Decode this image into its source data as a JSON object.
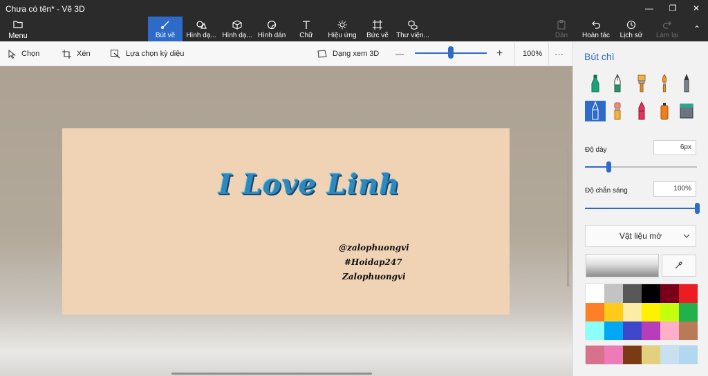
{
  "window": {
    "title": "Chưa có tên* - Vẽ 3D",
    "minimize_glyph": "—",
    "maximize_glyph": "❐",
    "close_glyph": "✕"
  },
  "menu": {
    "label": "Menu",
    "icon": "folder-icon"
  },
  "ribbon": {
    "tools": [
      {
        "label": "Bút vẽ",
        "icon": "brush-icon",
        "active": true
      },
      {
        "label": "Hình dạ...",
        "icon": "shapes-2d-icon",
        "active": false
      },
      {
        "label": "Hình dạ...",
        "icon": "cube-3d-icon",
        "active": false
      },
      {
        "label": "Hình dán",
        "icon": "sticker-icon",
        "active": false
      },
      {
        "label": "Chữ",
        "icon": "text-icon",
        "active": false
      },
      {
        "label": "Hiệu ứng",
        "icon": "effects-icon",
        "active": false
      },
      {
        "label": "Bức vẽ",
        "icon": "canvas-icon",
        "active": false
      },
      {
        "label": "Thư viện...",
        "icon": "library-icon",
        "active": false
      }
    ],
    "right": [
      {
        "label": "Dán",
        "icon": "paste-icon",
        "disabled": true
      },
      {
        "label": "Hoàn tác",
        "icon": "undo-icon",
        "disabled": false
      },
      {
        "label": "Lịch sử",
        "icon": "history-icon",
        "disabled": false
      },
      {
        "label": "Làm lại",
        "icon": "redo-icon",
        "disabled": true
      }
    ],
    "collapse_glyph": "⌃"
  },
  "subbar": {
    "select": "Chọn",
    "crop": "Xén",
    "magic_select": "Lựa chọn kỳ diệu",
    "view_3d": "Dạng xem 3D",
    "zoom_minus": "—",
    "zoom_plus": "+",
    "zoom_value": "100%",
    "zoom_level": 0.5,
    "more": "···"
  },
  "canvas": {
    "headline": "I Love Linh",
    "signature_lines": [
      "@zalophuongvi",
      "#Hoidap247",
      "Zalophuongvi"
    ]
  },
  "panel": {
    "title": "Bút chì",
    "brushes": [
      {
        "name": "marker",
        "color": "#1aa37a"
      },
      {
        "name": "calligraphy-pen",
        "color": "#2f8f6b"
      },
      {
        "name": "oil-brush",
        "color": "#f0b14a"
      },
      {
        "name": "watercolor",
        "color": "#e89a2e"
      },
      {
        "name": "pixel-pen",
        "color": "#7a7f88"
      },
      {
        "name": "pencil",
        "color": "#3b3b3b",
        "selected": true
      },
      {
        "name": "eraser",
        "color": "#ef8a7e"
      },
      {
        "name": "crayon",
        "color": "#e0345a"
      },
      {
        "name": "spray-can",
        "color": "#f07f1b"
      },
      {
        "name": "fill-bucket",
        "color": "#27a88e"
      }
    ],
    "thickness_label": "Độ dày",
    "thickness_value": "6px",
    "thickness_level": 0.21,
    "opacity_label": "Độ chắn sáng",
    "opacity_value": "100%",
    "opacity_level": 1.0,
    "material": "Vật liệu mờ",
    "palette": [
      "#ffffff",
      "#c3c3c3",
      "#585858",
      "#000000",
      "#7a0019",
      "#ec1c24",
      "#ff7f27",
      "#ffca18",
      "#fdeca6",
      "#fff200",
      "#c4ff0e",
      "#22b14c",
      "#8cfffb",
      "#00a8f3",
      "#3f48cc",
      "#b83dba",
      "#ffaec8",
      "#b97a56"
    ],
    "custom_palette": [
      "#d8728c",
      "#ee7ab8",
      "#7a3b14",
      "#e3d07c",
      "#c8e0f0",
      "#b2d8f0"
    ]
  }
}
